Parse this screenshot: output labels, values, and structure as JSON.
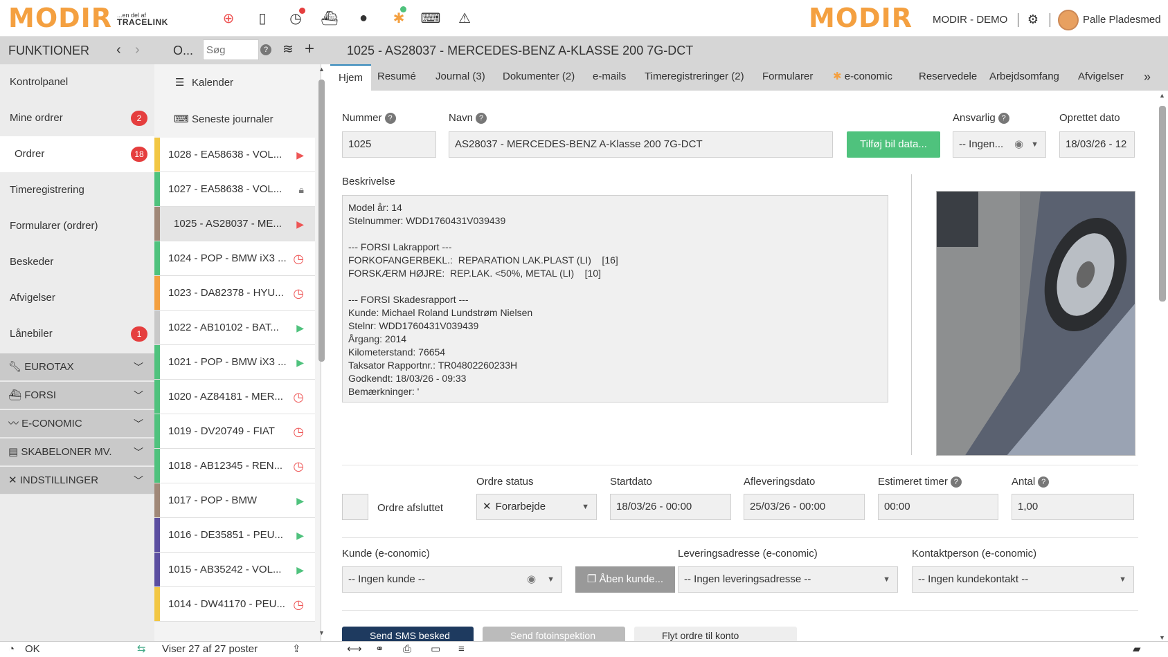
{
  "topbar": {
    "logo": "MODIR",
    "logo_sub_line1": "...en del af",
    "logo_sub_line2": "TRACELINK",
    "company": "MODIR - DEMO",
    "user": "Palle Pladesmed"
  },
  "header": {
    "section_title": "FUNKTIONER",
    "list_title": "O...",
    "search_placeholder": "Søg",
    "order_title": "1025 - AS28037 - MERCEDES-BENZ A-KLASSE 200 7G-DCT"
  },
  "nav": {
    "items": [
      {
        "label": "Kontrolpanel"
      },
      {
        "label": "Mine ordrer",
        "badge": "2"
      },
      {
        "label": "Ordrer",
        "badge": "18"
      },
      {
        "label": "Timeregistrering"
      },
      {
        "label": "Formularer (ordrer)"
      },
      {
        "label": "Beskeder"
      },
      {
        "label": "Afvigelser"
      },
      {
        "label": "Lånebiler",
        "badge": "1"
      }
    ],
    "groups": [
      {
        "label": "EUROTAX"
      },
      {
        "label": "FORSI"
      },
      {
        "label": "E-CONOMIC"
      },
      {
        "label": "SKABELONER MV."
      },
      {
        "label": "INDSTILLINGER"
      }
    ]
  },
  "orderlist": {
    "calendar": "Kalender",
    "recent": "Seneste journaler",
    "orders": [
      {
        "label": "1028 - EA58638 - VOL...",
        "color": "#f2c744",
        "icon": "play"
      },
      {
        "label": "1027 - EA58638 - VOL...",
        "color": "#4fc27d",
        "icon": "lock"
      },
      {
        "label": "1025 - AS28037 - ME...",
        "color": "#a08878",
        "icon": "play"
      },
      {
        "label": "1024 - POP - BMW iX3 ...",
        "color": "#4fc27d",
        "icon": "clock"
      },
      {
        "label": "1023 - DA82378 - HYU...",
        "color": "#f4a040",
        "icon": "clock"
      },
      {
        "label": "1022 - AB10102 - BAT...",
        "color": "#c8c8c8",
        "icon": "play-green"
      },
      {
        "label": "1021 - POP - BMW iX3 ...",
        "color": "#4fc27d",
        "icon": "play-green"
      },
      {
        "label": "1020 - AZ84181 - MER...",
        "color": "#4fc27d",
        "icon": "clock"
      },
      {
        "label": "1019 - DV20749 - FIAT",
        "color": "#4fc27d",
        "icon": "clock"
      },
      {
        "label": "1018 - AB12345 - REN...",
        "color": "#4fc27d",
        "icon": "clock"
      },
      {
        "label": "1017 - POP - BMW",
        "color": "#a08878",
        "icon": "play-green"
      },
      {
        "label": "1016 - DE35851 - PEU...",
        "color": "#5b4ea0",
        "icon": "play-green"
      },
      {
        "label": "1015 - AB35242 - VOL...",
        "color": "#5b4ea0",
        "icon": "play-green"
      },
      {
        "label": "1014 - DW41170 - PEU...",
        "color": "#f2c744",
        "icon": "clock"
      }
    ]
  },
  "tabs": [
    "Hjem",
    "Resumé",
    "Journal (3)",
    "Dokumenter (2)",
    "e-mails",
    "Timeregistreringer (2)",
    "Formularer",
    "e-conomic",
    "Reservedele",
    "Arbejdsomfang",
    "Afvigelser"
  ],
  "form": {
    "nummer_label": "Nummer",
    "nummer_value": "1025",
    "navn_label": "Navn",
    "navn_value": "AS28037 - MERCEDES-BENZ A-Klasse 200 7G-DCT",
    "add_car_button": "Tilføj bil data...",
    "ansvarlig_label": "Ansvarlig",
    "ansvarlig_value": "-- Ingen...",
    "oprettet_label": "Oprettet dato",
    "oprettet_value": "18/03/26 - 12",
    "beskrivelse_label": "Beskrivelse",
    "beskrivelse_value": "Model år: 14\nStelnummer: WDD1760431V039439\n\n--- FORSI Lakrapport ---\nFORKOFANGERBEKL.:  REPARATION LAK.PLAST (LI)    [16]\nFORSKÆRM HØJRE:  REP.LAK. <50%, METAL (LI)    [10]\n\n--- FORSI Skadesrapport ---\nKunde: Michael Roland Lundstrøm Nielsen\nStelnr: WDD1760431V039439\nÅrgang: 2014\nKilometerstand: 76654\nTaksator Rapportnr.: TR04802260233H\nGodkendt: 18/03/26 - 09:33\nBemærkninger: '",
    "ordre_afsluttet_label": "Ordre afsluttet",
    "ordre_status_label": "Ordre status",
    "ordre_status_value": "Forarbejde",
    "startdato_label": "Startdato",
    "startdato_value": "18/03/26 - 00:00",
    "aflevering_label": "Afleveringsdato",
    "aflevering_value": "25/03/26 - 00:00",
    "estimeret_label": "Estimeret timer",
    "estimeret_value": "00:00",
    "antal_label": "Antal",
    "antal_value": "1,00",
    "kunde_label": "Kunde (e-conomic)",
    "kunde_value": "-- Ingen kunde --",
    "aaben_kunde_button": "Åben kunde...",
    "levering_label": "Leveringsadresse (e-conomic)",
    "levering_value": "-- Ingen leveringsadresse --",
    "kontakt_label": "Kontaktperson (e-conomic)",
    "kontakt_value": "-- Ingen kundekontakt --",
    "sms_button": "Send SMS besked",
    "foto_button": "Send fotoinspektion",
    "flyt_button": "Flyt ordre til konto"
  },
  "statusbar": {
    "status": "OK",
    "count": "Viser 27 af 27 poster"
  }
}
